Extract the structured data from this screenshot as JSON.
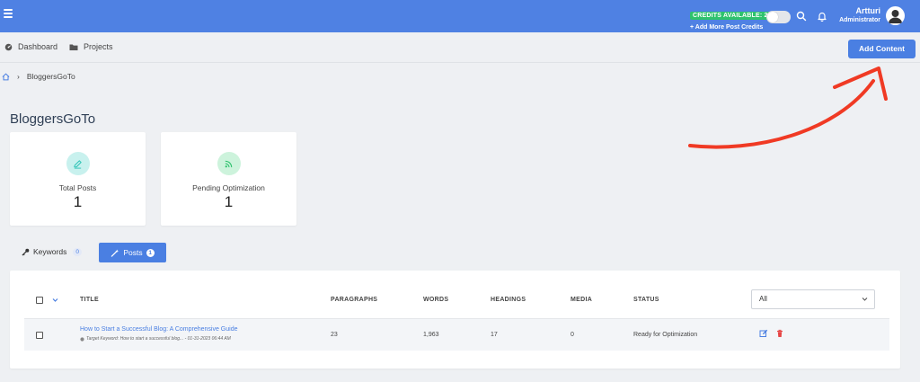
{
  "topbar": {
    "credits_badge": "CREDITS AVAILABLE: 2",
    "credits_link": "+ Add More Post Credits",
    "user_name": "Artturi",
    "user_role": "Administrator"
  },
  "nav": {
    "items": [
      {
        "label": "Dashboard",
        "icon": "dashboard-icon"
      },
      {
        "label": "Projects",
        "icon": "folder-icon"
      }
    ],
    "add_button": "Add Content"
  },
  "breadcrumb": {
    "separator": "›",
    "current": "BloggersGoTo"
  },
  "page": {
    "title": "BloggersGoTo"
  },
  "stats": [
    {
      "label": "Total Posts",
      "value": "1",
      "icon": "pencil-icon",
      "color": "#2ec4b6"
    },
    {
      "label": "Pending Optimization",
      "value": "1",
      "icon": "rss-icon",
      "color": "#2ec26d"
    }
  ],
  "tabs": {
    "keywords": {
      "label": "Keywords",
      "count": "0"
    },
    "posts": {
      "label": "Posts",
      "count": "1"
    }
  },
  "table": {
    "headers": {
      "title": "TITLE",
      "paragraphs": "PARAGRAPHS",
      "words": "WORDS",
      "headings": "HEADINGS",
      "media": "MEDIA",
      "status": "STATUS"
    },
    "filter": {
      "selected": "All"
    },
    "rows": [
      {
        "title": "How to Start a Successful Blog: A Comprehensive Guide",
        "meta": "Target Keyword: How to start a successful blog... - 01-31-2023 06:44 AM",
        "paragraphs": "23",
        "words": "1,963",
        "headings": "17",
        "media": "0",
        "status": "Ready for Optimization"
      }
    ]
  },
  "colors": {
    "primary": "#4a7fe2",
    "topbar": "#4f81e3",
    "success": "#2ec26d",
    "danger": "#e64545",
    "annotation": "#f03a24"
  }
}
